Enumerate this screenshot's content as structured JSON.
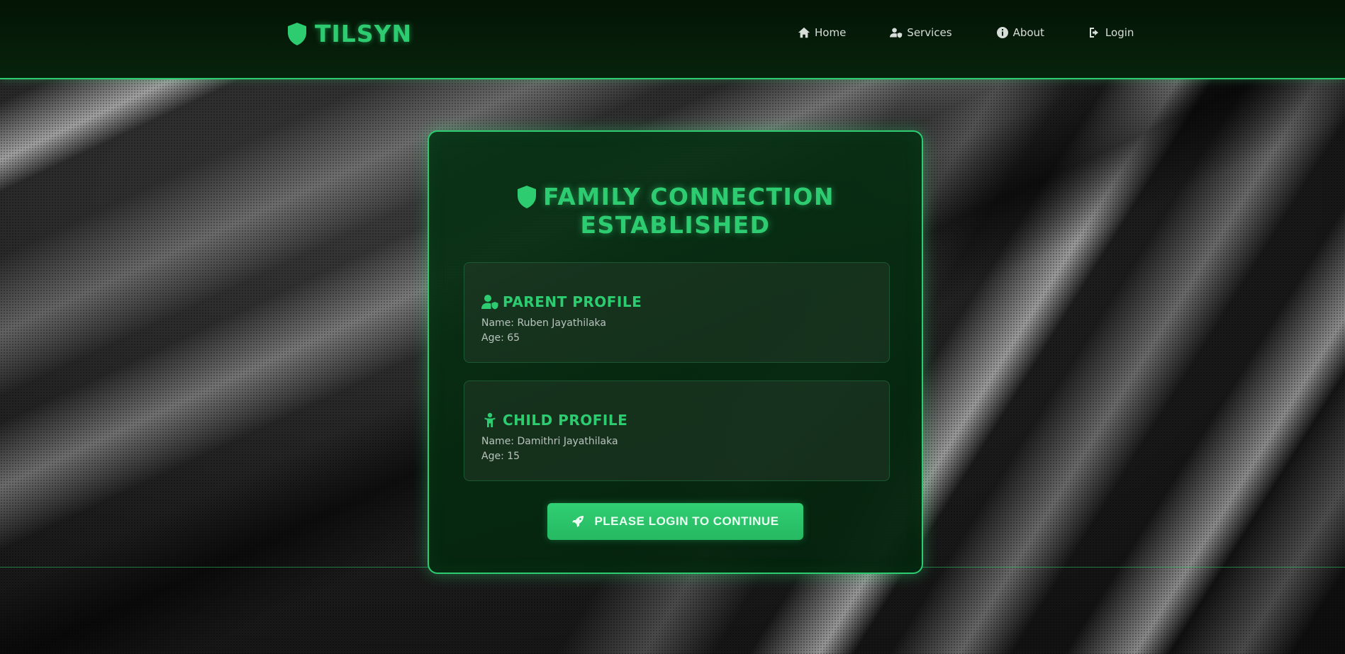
{
  "brand": {
    "name": "TILSYN",
    "icon": "shield-icon"
  },
  "nav": [
    {
      "label": "Home",
      "icon": "home-icon"
    },
    {
      "label": "Services",
      "icon": "user-shield-icon"
    },
    {
      "label": "About",
      "icon": "info-icon"
    },
    {
      "label": "Login",
      "icon": "sign-in-icon"
    }
  ],
  "card": {
    "title_line1": "FAMILY CONNECTION",
    "title_line2": "ESTABLISHED",
    "parent": {
      "heading": "PARENT PROFILE",
      "name": "Name: Ruben Jayathilaka",
      "age": "Age: 65"
    },
    "child": {
      "heading": "CHILD PROFILE",
      "name": "Name: Damithri Jayathilaka",
      "age": "Age: 15"
    },
    "button_label": "PLEASE LOGIN TO CONTINUE"
  },
  "colors": {
    "accent": "#2ecc71",
    "header_bg": "#041405",
    "card_bg": "#06300f"
  }
}
